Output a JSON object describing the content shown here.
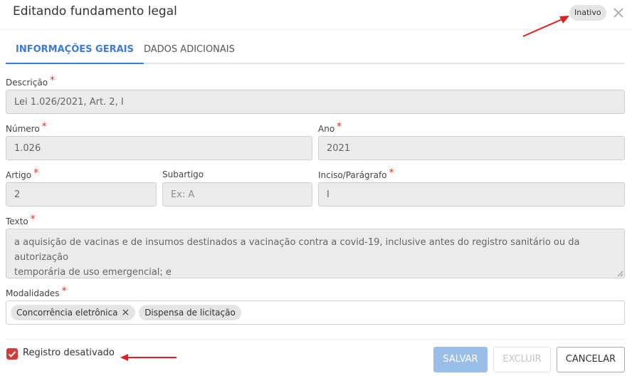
{
  "modal": {
    "title": "Editando fundamento legal",
    "status_badge": "Inativo"
  },
  "tabs": [
    {
      "label": "INFORMAÇÕES GERAIS",
      "active": true
    },
    {
      "label": "DADOS ADICIONAIS",
      "active": false
    }
  ],
  "form": {
    "descricao": {
      "label": "Descrição",
      "required": true,
      "value": "Lei 1.026/2021, Art. 2, I"
    },
    "numero": {
      "label": "Número",
      "required": true,
      "value": "1.026"
    },
    "ano": {
      "label": "Ano",
      "required": true,
      "value": "2021"
    },
    "artigo": {
      "label": "Artigo",
      "required": true,
      "value": "2"
    },
    "subartigo": {
      "label": "Subartigo",
      "required": false,
      "placeholder": "Ex: A"
    },
    "inciso": {
      "label": "Inciso/Parágrafo",
      "required": true,
      "value": "I"
    },
    "texto": {
      "label": "Texto",
      "required": true,
      "value_line1": "a aquisição de vacinas e de insumos destinados a vacinação contra a covid-19, inclusive antes do registro sanitário ou da autorização",
      "value_line2": "temporária de uso emergencial; e"
    },
    "modalidades": {
      "label": "Modalidades",
      "required": true,
      "tags": [
        {
          "label": "Concorrência eletrônica",
          "removable": true
        },
        {
          "label": "Dispensa de licitação",
          "removable": false
        }
      ]
    }
  },
  "required_marker": "*",
  "footer": {
    "checkbox_label": "Registro desativado",
    "checkbox_checked": true,
    "save_label": "SALVAR",
    "delete_label": "EXCLUIR",
    "cancel_label": "CANCELAR"
  },
  "icons": {
    "close": "close-icon",
    "check": "check-icon",
    "tag_remove": "remove-icon"
  },
  "colors": {
    "accent": "#3b7ad9",
    "required": "#d9302c",
    "annotation_arrow": "#e0201c",
    "checkbox": "#d23b3b",
    "save_button": "#9bbde9"
  }
}
